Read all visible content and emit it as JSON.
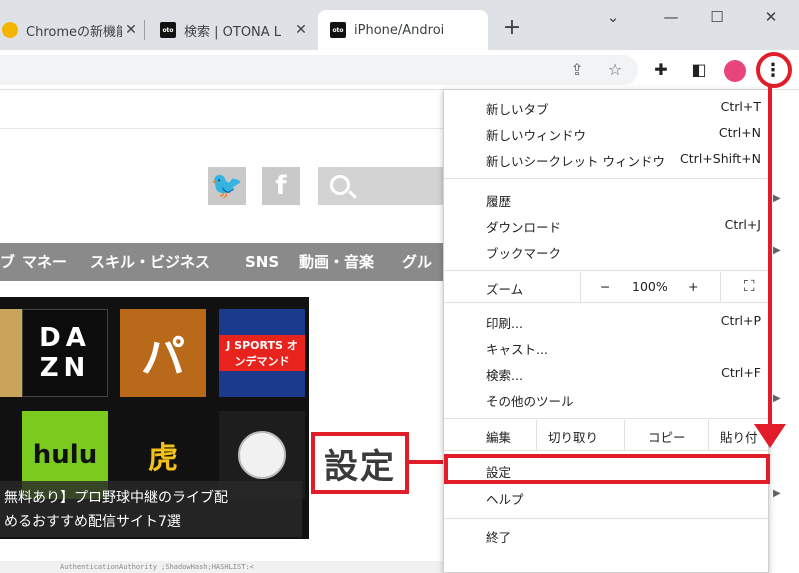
{
  "tabs": [
    {
      "title": "Chromeの新機能",
      "favicon": "chrome-icon"
    },
    {
      "title": "検索 | OTONA L",
      "favicon": "oto"
    },
    {
      "title": "iPhone/Androi",
      "favicon": "oto",
      "active": true
    }
  ],
  "tab_close": "✕",
  "new_tab": "+",
  "window": {
    "minimize": "—",
    "maximize": "☐",
    "close": "✕",
    "dropdown": "⌄"
  },
  "toolbar": {
    "kebab": "⋮"
  },
  "nav_items": [
    "ブ",
    "マネー",
    "スキル・ビジネス",
    "SNS",
    "動画・音楽",
    "グル"
  ],
  "thumbnail": {
    "dazn": "DA ZN",
    "pa": "パ",
    "jsports": "J SPORTS オンデマンド",
    "hulu": "hulu",
    "tora": "虎",
    "caption_lines": [
      "無料あり】プロ野球中継のライブ配",
      "めるおすすめ配信サイト7選"
    ]
  },
  "callout": "設定",
  "menu": {
    "new_tab": {
      "label": "新しいタブ",
      "shortcut": "Ctrl+T"
    },
    "new_window": {
      "label": "新しいウィンドウ",
      "shortcut": "Ctrl+N"
    },
    "new_incognito": {
      "label": "新しいシークレット ウィンドウ",
      "shortcut": "Ctrl+Shift+N"
    },
    "history": {
      "label": "履歴"
    },
    "downloads": {
      "label": "ダウンロード",
      "shortcut": "Ctrl+J"
    },
    "bookmarks": {
      "label": "ブックマーク"
    },
    "zoom": {
      "label": "ズーム",
      "minus": "−",
      "value": "100%",
      "plus": "+"
    },
    "print": {
      "label": "印刷...",
      "shortcut": "Ctrl+P"
    },
    "cast": {
      "label": "キャスト..."
    },
    "find": {
      "label": "検索...",
      "shortcut": "Ctrl+F"
    },
    "more_tools": {
      "label": "その他のツール"
    },
    "edit": {
      "label": "編集",
      "cut": "切り取り",
      "copy": "コピー",
      "paste": "貼り付"
    },
    "settings": {
      "label": "設定"
    },
    "help": {
      "label": "ヘルプ"
    },
    "exit": {
      "label": "終了"
    }
  },
  "bottom_strip_text": "AuthenticationAuthority        ;ShadowHash;HASHLIST:<"
}
